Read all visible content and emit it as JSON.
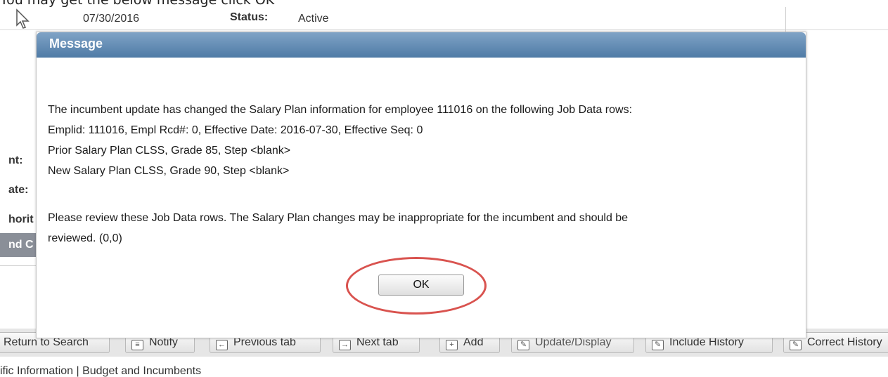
{
  "caption": "You may get the below message click OK",
  "background": {
    "date_value": "07/30/2016",
    "status_label": "Status:",
    "status_value": "Active",
    "side_labels": [
      "nt:",
      "ate:",
      "horit"
    ],
    "side_bar_text": "nd C"
  },
  "toolbar": {
    "buttons": [
      {
        "label": "Return to Search",
        "icon": "return-icon"
      },
      {
        "label": "Notify",
        "icon": "notify-icon"
      },
      {
        "label": "Previous tab",
        "icon": "previous-tab-icon"
      },
      {
        "label": "Next tab",
        "icon": "next-tab-icon"
      },
      {
        "label": "Add",
        "icon": "add-icon"
      },
      {
        "label": "Update/Display",
        "icon": "update-display-icon"
      },
      {
        "label": "Include History",
        "icon": "include-history-icon"
      },
      {
        "label": "Correct History",
        "icon": "correct-history-icon"
      }
    ]
  },
  "bottom_links": "ific Information | Budget and Incumbents",
  "modal": {
    "title": "Message",
    "lines": [
      "The incumbent update has changed the Salary Plan information for employee 111016 on the following Job Data rows:",
      "Emplid: 111016, Empl Rcd#: 0, Effective Date: 2016-07-30, Effective Seq: 0",
      "Prior Salary Plan CLSS, Grade 85, Step <blank>",
      "New Salary Plan CLSS, Grade 90, Step <blank>"
    ],
    "review_lines": [
      "Please review these Job Data rows.  The Salary Plan changes may be inappropriate for the incumbent and should be",
      "reviewed. (0,0)"
    ],
    "ok_label": "OK"
  },
  "colors": {
    "header_top": "#7fa3c6",
    "header_bottom": "#4f7ba6",
    "highlight": "#d9534f"
  }
}
